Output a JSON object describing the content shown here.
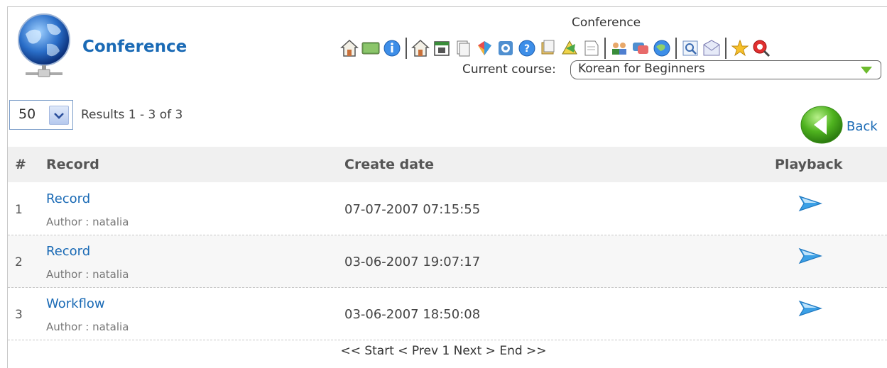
{
  "app": {
    "title": "Conference"
  },
  "toolbar": {
    "title": "Conference",
    "groups": [
      [
        "home-icon",
        "chalkboard-icon",
        "info-icon"
      ],
      [
        "course-home-icon",
        "calendar-icon",
        "documents-icon",
        "links-icon",
        "assignments-icon",
        "help-icon",
        "announcements-icon",
        "exercises-icon",
        "notes-icon"
      ],
      [
        "users-icon",
        "chat-icon",
        "web-icon"
      ],
      [
        "search-icon",
        "message-icon"
      ],
      [
        "favorite-icon",
        "logout-icon"
      ]
    ]
  },
  "course": {
    "label": "Current course:",
    "value": "Korean for Beginners"
  },
  "list": {
    "per_page": "50",
    "results_text": "Results 1 - 3 of 3",
    "back_label": "Back"
  },
  "table": {
    "headers": {
      "num": "#",
      "record": "Record",
      "date": "Create date",
      "playback": "Playback"
    },
    "rows": [
      {
        "num": "1",
        "title": "Record",
        "author": "Author :  natalia",
        "date": "07-07-2007 07:15:55"
      },
      {
        "num": "2",
        "title": "Record",
        "author": "Author :  natalia",
        "date": "03-06-2007 19:07:17"
      },
      {
        "num": "3",
        "title": "Workflow",
        "author": "Author :  natalia",
        "date": "03-06-2007 18:50:08"
      }
    ]
  },
  "pager": {
    "start": "<< Start",
    "prev": "< Prev",
    "page": "1",
    "next": "Next >",
    "end": "End >>"
  },
  "colors": {
    "link": "#1a6ab5",
    "header_bg": "#f0f0f0",
    "back_green": "#4fb31f"
  }
}
